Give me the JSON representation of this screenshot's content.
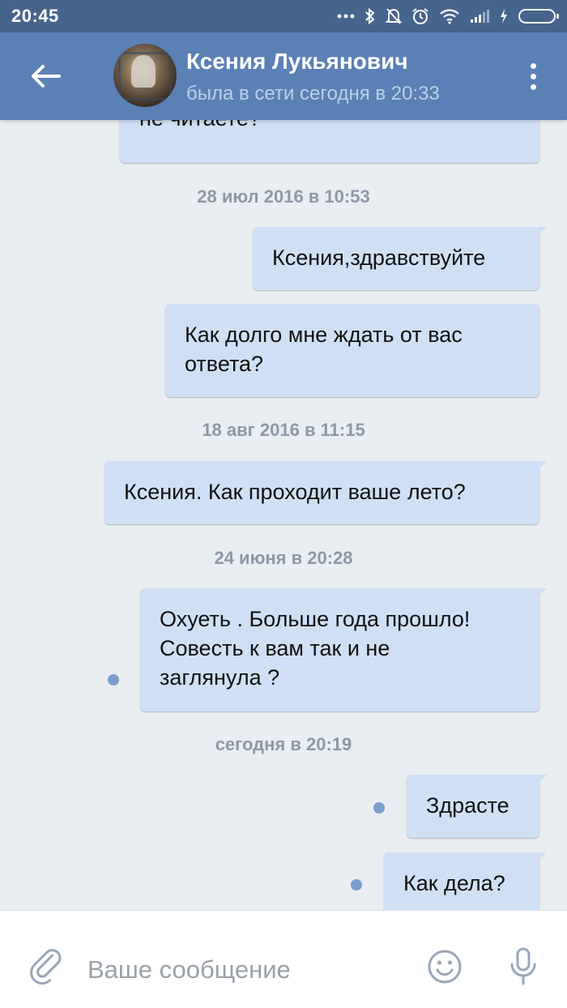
{
  "status_bar": {
    "time": "20:45",
    "icons": [
      "more-dots-icon",
      "bluetooth-icon",
      "mute-bell-icon",
      "alarm-icon",
      "wifi-icon",
      "signal-icon",
      "charging-icon",
      "battery-icon"
    ]
  },
  "header": {
    "contact_name": "Ксения Лукьянович",
    "contact_status": "была в сети сегодня в 20:33"
  },
  "conversation": {
    "dates": [
      "28 июл 2016 в 10:53",
      "18 авг 2016 в 11:15",
      "24 июня в 20:28",
      "сегодня в 20:19"
    ],
    "messages": [
      {
        "lines": [
          "не читаете?"
        ]
      },
      {
        "lines": [
          "Ксения,здравствуйте"
        ]
      },
      {
        "lines": [
          "Как долго мне ждать от вас",
          "ответа?"
        ]
      },
      {
        "lines": [
          "Ксения. Как проходит ваше лето?"
        ]
      },
      {
        "lines": [
          "Охуеть . Больше года прошло!",
          "Совесть к вам так и не",
          "заглянула ?"
        ],
        "unread": true
      },
      {
        "lines": [
          "Здрасте"
        ],
        "unread": true
      },
      {
        "lines": [
          "Как дела?"
        ],
        "unread": true
      }
    ]
  },
  "composer": {
    "placeholder": "Ваше сообщение"
  },
  "colors": {
    "status_bar": "#46648c",
    "header": "#5b80b5",
    "background": "#e9eef3",
    "bubble": "#cfe0f5",
    "unread_dot": "#7a9fcf"
  }
}
